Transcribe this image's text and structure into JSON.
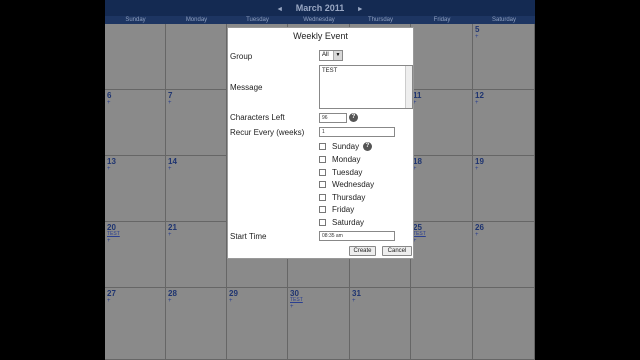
{
  "calendar": {
    "month_title": "March 2011",
    "prev_label": "◄",
    "next_label": "►",
    "weekdays": [
      "Sunday",
      "Monday",
      "Tuesday",
      "Wednesday",
      "Thursday",
      "Friday",
      "Saturday"
    ],
    "visible_days": {
      "d5": "5",
      "d6": "6",
      "d7": "7",
      "d11": "11",
      "d12": "12",
      "d13": "13",
      "d14": "14",
      "d18": "18",
      "d19": "19",
      "d20": "20",
      "d21": "21",
      "d25": "25",
      "d26": "26",
      "d27": "27",
      "d28": "28",
      "d29": "29",
      "d30": "30",
      "d31": "31"
    },
    "plus": "+",
    "event_label": "TEST"
  },
  "dialog": {
    "title": "Weekly Event",
    "group_label": "Group",
    "group_value": "All",
    "message_label": "Message",
    "message_value": "TEST",
    "chars_left_label": "Characters Left",
    "chars_left_value": "96",
    "recur_label": "Recur Every (weeks)",
    "recur_value": "1",
    "days": [
      "Sunday",
      "Monday",
      "Tuesday",
      "Wednesday",
      "Thursday",
      "Friday",
      "Saturday"
    ],
    "start_time_label": "Start Time",
    "start_time_value": "08:35 am",
    "create_label": "Create",
    "cancel_label": "Cancel",
    "help_glyph": "?"
  },
  "colors": {
    "header": "#142a52",
    "overlay": "#7c7c7c",
    "dialog_bg": "#ffffff"
  }
}
